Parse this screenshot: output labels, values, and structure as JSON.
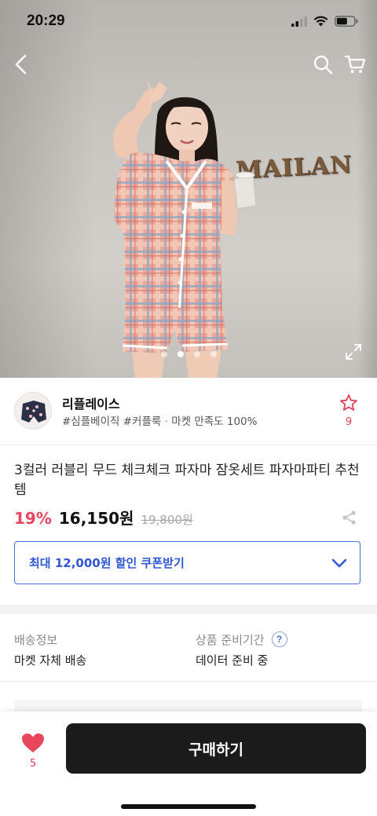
{
  "status_bar": {
    "time": "20:29"
  },
  "hero": {
    "sign_text": "MAILAN",
    "slide_count": 4,
    "active_slide": 1
  },
  "store": {
    "name": "리플레이스",
    "tags": [
      "#심플베이직",
      "#커플룩"
    ],
    "satisfaction": "마켓 만족도 100%",
    "favorite_count": "9"
  },
  "product": {
    "title": "3컬러 러블리 무드 체크체크 파자마 잠옷세트 파자마파티 추천템",
    "discount": "19%",
    "price": "16,150원",
    "original_price": "19,800원"
  },
  "coupon": {
    "label": "최대 12,000원 할인 쿠폰받기"
  },
  "shipping": {
    "label": "배송정보",
    "value": "마켓 자체 배송"
  },
  "preparation": {
    "label": "상품 준비기간",
    "help": "?",
    "value": "데이터 준비 중"
  },
  "bottom_bar": {
    "like_count": "5",
    "buy_label": "구매하기"
  },
  "colors": {
    "accent_red": "#e8465d",
    "coupon_blue": "#2f57d6",
    "buy_button": "#1b1b1b"
  },
  "icons": [
    "back-icon",
    "search-icon",
    "cart-icon",
    "expand-icon",
    "star-icon",
    "share-icon",
    "chevron-down-icon",
    "heart-icon",
    "signal-icon",
    "wifi-icon",
    "battery-icon"
  ]
}
